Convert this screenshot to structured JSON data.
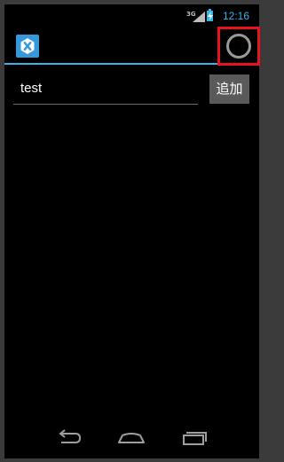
{
  "status_bar": {
    "network": "3G",
    "time": "12:16"
  },
  "action_bar": {
    "logo_icon": "xamarin-logo-icon",
    "refresh_icon": "progress-spinner-icon"
  },
  "form": {
    "text_value": "test",
    "add_label": "追加"
  },
  "nav_bar": {
    "back_icon": "back-icon",
    "home_icon": "home-icon",
    "recents_icon": "recents-icon"
  },
  "colors": {
    "accent": "#33b5e5",
    "highlight": "#e8141c",
    "logo_bg": "#3498db"
  }
}
